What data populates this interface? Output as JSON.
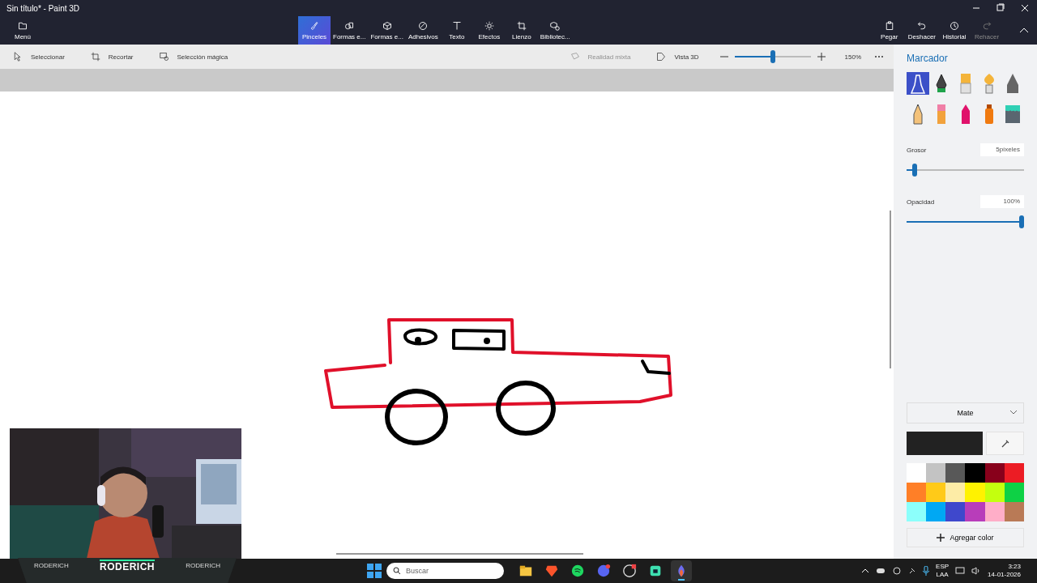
{
  "window": {
    "title": "Sin título* - Paint 3D"
  },
  "ribbon": {
    "menu": "Menú",
    "tools": [
      {
        "kind": "brushes",
        "label": "Pinceles",
        "selected": true
      },
      {
        "kind": "shapes2d",
        "label": "Formas e...",
        "selected": false
      },
      {
        "kind": "shapes3d",
        "label": "Formas e...",
        "selected": false
      },
      {
        "kind": "stickers",
        "label": "Adhesivos",
        "selected": false
      },
      {
        "kind": "text",
        "label": "Texto",
        "selected": false
      },
      {
        "kind": "effects",
        "label": "Efectos",
        "selected": false
      },
      {
        "kind": "canvas",
        "label": "Lienzo",
        "selected": false
      },
      {
        "kind": "library",
        "label": "Bibliotec...",
        "selected": false
      }
    ],
    "actions": [
      {
        "kind": "paste",
        "label": "Pegar",
        "disabled": false
      },
      {
        "kind": "undo",
        "label": "Deshacer",
        "disabled": false
      },
      {
        "kind": "history",
        "label": "Historial",
        "disabled": false
      },
      {
        "kind": "redo",
        "label": "Rehacer",
        "disabled": true
      }
    ]
  },
  "toolbar": {
    "tools": [
      {
        "kind": "select",
        "label": "Seleccionar"
      },
      {
        "kind": "crop",
        "label": "Recortar"
      },
      {
        "kind": "magic",
        "label": "Selección mágica"
      }
    ],
    "mixed_reality": {
      "label": "Realidad mixta",
      "disabled": true
    },
    "view_3d": "Vista 3D",
    "zoom": {
      "level": 0.5,
      "reading": "150%"
    }
  },
  "panel": {
    "title": "Marcador",
    "brushes": [
      {
        "kind": "marker",
        "selected": true
      },
      {
        "kind": "pen",
        "selected": false
      },
      {
        "kind": "oil",
        "selected": false
      },
      {
        "kind": "watercolor",
        "selected": false
      },
      {
        "kind": "pixel",
        "selected": false
      },
      {
        "kind": "pencil",
        "selected": false
      },
      {
        "kind": "eraser",
        "selected": false
      },
      {
        "kind": "crayon",
        "selected": false
      },
      {
        "kind": "spray",
        "selected": false
      },
      {
        "kind": "fill",
        "selected": false
      }
    ],
    "thickness": {
      "label": "Grosor",
      "value": "5píxeles",
      "level": 0.05
    },
    "opacity": {
      "label": "Opacidad",
      "value": "100%",
      "level": 1
    },
    "finish": "Mate",
    "current_color": {
      "color": "#222222"
    },
    "palette": [
      {
        "color": "#ffffff"
      },
      {
        "color": "#c3c3c3"
      },
      {
        "color": "#585858"
      },
      {
        "color": "#000000"
      },
      {
        "color": "#88001b"
      },
      {
        "color": "#ec1c24"
      },
      {
        "color": "#ff7f27"
      },
      {
        "color": "#ffca18"
      },
      {
        "color": "#fdeca6"
      },
      {
        "color": "#fff200"
      },
      {
        "color": "#c4ff0e"
      },
      {
        "color": "#0ed145"
      },
      {
        "color": "#8cfffb"
      },
      {
        "color": "#00a8f3"
      },
      {
        "color": "#3f48cc"
      },
      {
        "color": "#b83dba"
      },
      {
        "color": "#ffaec8"
      },
      {
        "color": "#b97a56"
      }
    ],
    "add_color": "Agregar color"
  },
  "stream_overlay": {
    "name": "RODERICH",
    "side_labels": [
      "RODERICH",
      "RODERICH"
    ]
  },
  "taskbar": {
    "search_placeholder": "Buscar",
    "apps": [
      {
        "kind": "files",
        "selected": false
      },
      {
        "kind": "brave",
        "selected": false
      },
      {
        "kind": "spotify",
        "selected": false
      },
      {
        "kind": "discord",
        "selected": false
      },
      {
        "kind": "obs",
        "selected": false
      },
      {
        "kind": "app",
        "selected": false
      },
      {
        "kind": "paint3d",
        "selected": true
      }
    ],
    "language": [
      "ESP",
      "LAA"
    ],
    "time": "3:23",
    "date": "14-01-2026"
  }
}
